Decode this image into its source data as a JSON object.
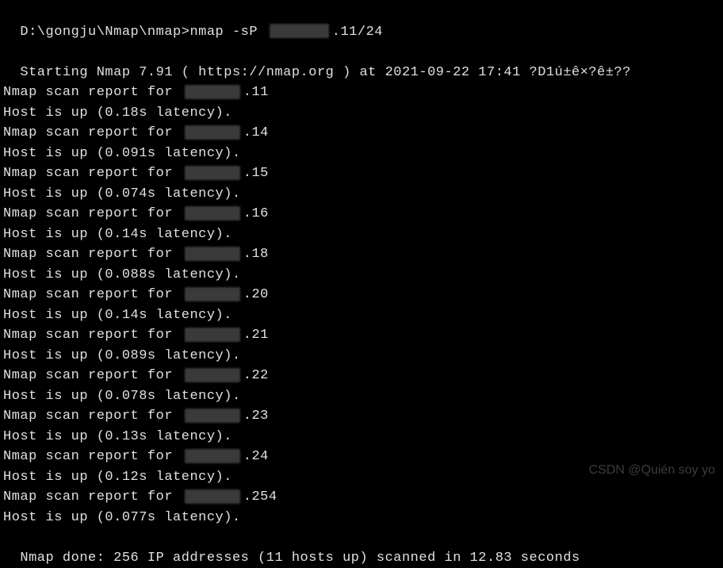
{
  "prompt": {
    "path": "D:\\gongju\\Nmap\\nmap>",
    "command": "nmap -sP",
    "target_suffix": ".11/24"
  },
  "starting_line": "Starting Nmap 7.91 ( https://nmap.org ) at 2021-09-22 17:41 ?D1ú±ê×?ê±??",
  "report_prefix": "Nmap scan report for ",
  "host_up_prefix": "Host is up (",
  "host_up_suffix": " latency).",
  "hosts": [
    {
      "ip_suffix": ".11",
      "latency": "0.18s"
    },
    {
      "ip_suffix": ".14",
      "latency": "0.091s"
    },
    {
      "ip_suffix": ".15",
      "latency": "0.074s"
    },
    {
      "ip_suffix": ".16",
      "latency": "0.14s"
    },
    {
      "ip_suffix": ".18",
      "latency": "0.088s"
    },
    {
      "ip_suffix": ".20",
      "latency": "0.14s"
    },
    {
      "ip_suffix": ".21",
      "latency": "0.089s"
    },
    {
      "ip_suffix": ".22",
      "latency": "0.078s"
    },
    {
      "ip_suffix": ".23",
      "latency": "0.13s"
    },
    {
      "ip_suffix": ".24",
      "latency": "0.12s"
    },
    {
      "ip_suffix": ".254",
      "latency": "0.077s"
    }
  ],
  "done_line": "Nmap done: 256 IP addresses (11 hosts up) scanned in 12.83 seconds",
  "watermark": "CSDN @Quién soy yo"
}
